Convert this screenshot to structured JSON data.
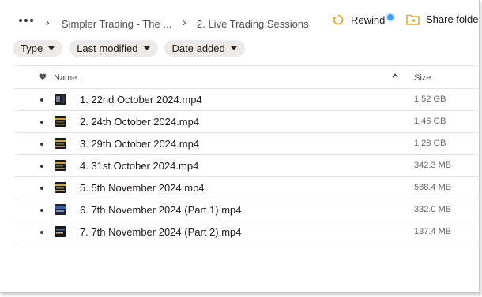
{
  "breadcrumb": {
    "items": [
      {
        "label": "Simpler Trading - The ..."
      },
      {
        "label": "2. Live Trading Sessions"
      }
    ]
  },
  "toolbar": {
    "rewind_label": "Rewind",
    "share_label": "Share folder",
    "rewind_icon": "rewind-icon",
    "share_icon": "share-folder-icon",
    "accent": "#e8a92a"
  },
  "filters": [
    {
      "label": "Type"
    },
    {
      "label": "Last modified"
    },
    {
      "label": "Date added"
    }
  ],
  "table": {
    "columns": {
      "name": "Name",
      "size": "Size"
    },
    "sort": "ascending",
    "rows": [
      {
        "name": "1. 22nd October 2024.mp4",
        "size": "1.52 GB",
        "thumb": "video-thumbnail-icon"
      },
      {
        "name": "2. 24th October 2024.mp4",
        "size": "1.46 GB",
        "thumb": "video-thumbnail-icon"
      },
      {
        "name": "3. 29th October 2024.mp4",
        "size": "1.28 GB",
        "thumb": "video-thumbnail-icon"
      },
      {
        "name": "4. 31st October 2024.mp4",
        "size": "342.3 MB",
        "thumb": "video-thumbnail-icon"
      },
      {
        "name": "5. 5th November 2024.mp4",
        "size": "588.4 MB",
        "thumb": "video-thumbnail-icon"
      },
      {
        "name": "6. 7th November 2024 (Part 1).mp4",
        "size": "332.0 MB",
        "thumb": "video-thumbnail-icon"
      },
      {
        "name": "7. 7th November 2024 (Part 2).mp4",
        "size": "137.4 MB",
        "thumb": "video-thumbnail-icon"
      }
    ]
  }
}
